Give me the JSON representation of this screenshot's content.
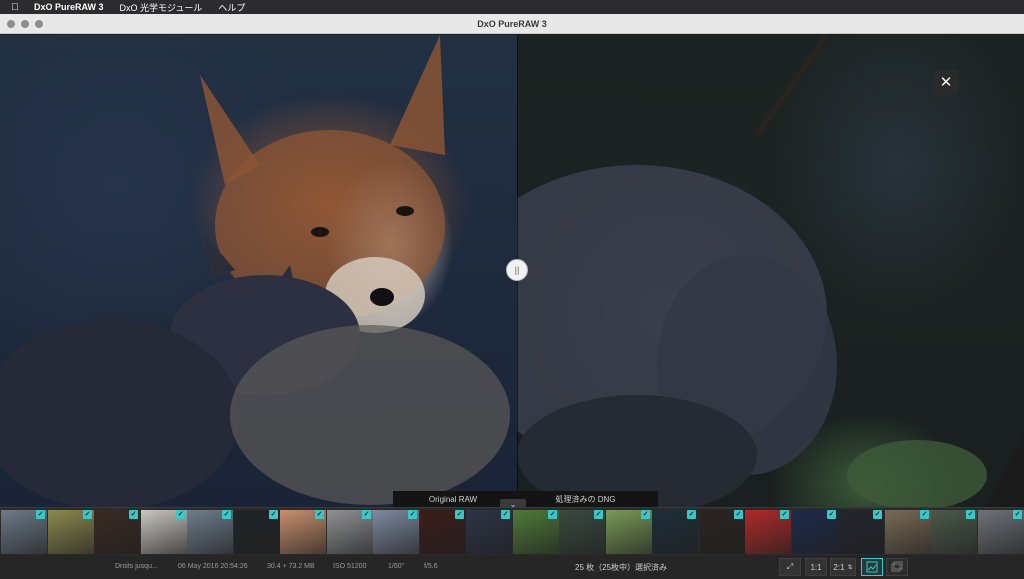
{
  "menubar": {
    "apple_icon": "apple-icon",
    "items": [
      "DxO PureRAW 3",
      "DxO 光学モジュール",
      "ヘルプ"
    ]
  },
  "window": {
    "title": "DxO PureRAW 3"
  },
  "viewer": {
    "close_glyph": "✕",
    "split_handle_glyph": "||",
    "labels": {
      "left": "Original RAW",
      "right": "処理済みの DNG"
    },
    "toggle_glyph": "⌄"
  },
  "filmstrip": {
    "check_glyph": "✓",
    "thumbnails": [
      {
        "color": "#6c7a88",
        "checked": true
      },
      {
        "color": "#8d8a4f",
        "checked": true
      },
      {
        "color": "#3a2a22",
        "checked": true
      },
      {
        "color": "#c9c6c0",
        "checked": true
      },
      {
        "color": "#6e7d8c",
        "checked": true
      },
      {
        "color": "#1f2528",
        "checked": true
      },
      {
        "color": "#c9906e",
        "checked": true
      },
      {
        "color": "#8f9294",
        "checked": true
      },
      {
        "color": "#7e8aa0",
        "checked": true
      },
      {
        "color": "#3a1d1a",
        "checked": true
      },
      {
        "color": "#2c3446",
        "checked": true
      },
      {
        "color": "#4f7a3a",
        "checked": true
      },
      {
        "color": "#3a4a40",
        "checked": true
      },
      {
        "color": "#7a9a58",
        "checked": true
      },
      {
        "color": "#1e2e3a",
        "checked": true
      },
      {
        "color": "#2a2422",
        "checked": true
      },
      {
        "color": "#b02a2a",
        "checked": true
      },
      {
        "color": "#1d2a4a",
        "checked": true
      },
      {
        "color": "#22262e",
        "checked": true
      },
      {
        "color": "#7a6a54",
        "checked": true
      },
      {
        "color": "#4a5a4a",
        "checked": true
      },
      {
        "color": "#6e7278",
        "checked": true
      }
    ]
  },
  "statusbar": {
    "copyright": "Droits jusqu...",
    "date": "06 May 2016 20:54:26",
    "size": "30.4 + 73.2 MB",
    "iso": "ISO 51200",
    "shutter": "1/60\"",
    "aperture": "f/5.6",
    "selection": "25 枚（25枚中）選択済み",
    "buttons": {
      "fit": "⤢",
      "one_to_one": "1:1",
      "zoom": "2:1",
      "compare": "compare-view-icon",
      "single": "single-view-icon"
    }
  }
}
